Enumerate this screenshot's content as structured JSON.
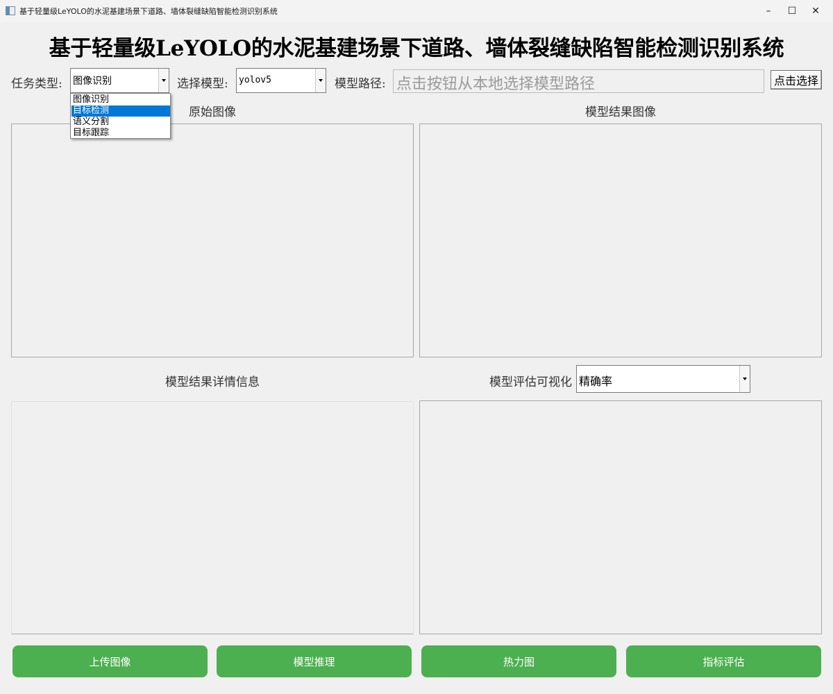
{
  "window": {
    "title": "基于轻量级LeYOLO的水泥基建场景下道路、墙体裂缝缺陷智能检测识别系统",
    "controls": {
      "minimize": "–",
      "maximize": "☐",
      "close": "✕"
    }
  },
  "header": {
    "title": "基于轻量级LeYOLO的水泥基建场景下道路、墙体裂缝缺陷智能检测识别系统"
  },
  "toolbar": {
    "task_label": "任务类型:",
    "task_value": "图像识别",
    "task_options": [
      "图像识别",
      "目标检测",
      "语义分割",
      "目标跟踪"
    ],
    "task_highlighted": "目标检测",
    "model_label": "选择模型:",
    "model_value": "yolov5",
    "path_label": "模型路径:",
    "path_placeholder": "点击按钮从本地选择模型路径",
    "pick_button": "点击选择"
  },
  "panels": {
    "original_title": "原始图像",
    "result_title": "模型结果图像",
    "details_title": "模型结果详情信息",
    "eval_title": "模型评估可视化",
    "eval_metric": "精确率"
  },
  "buttons": {
    "upload": "上传图像",
    "inference": "模型推理",
    "heatmap": "热力图",
    "evaluate": "指标评估"
  },
  "colors": {
    "accent_green": "#4caf50",
    "selection_blue": "#0078d7"
  }
}
